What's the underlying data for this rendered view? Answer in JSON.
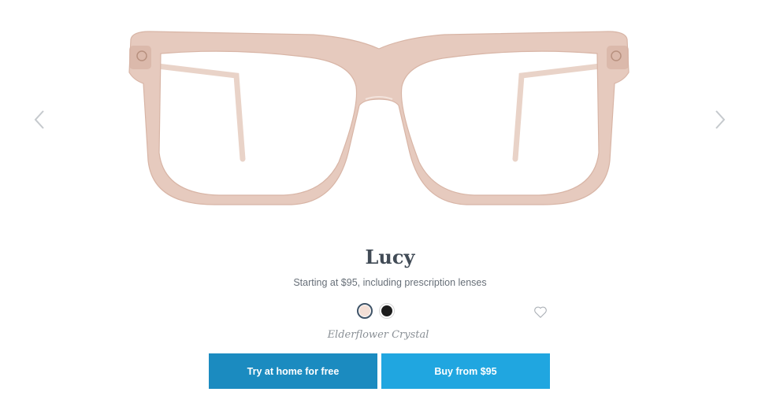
{
  "product": {
    "name": "Lucy",
    "price_text": "Starting at $95, including prescription lenses",
    "selected_color": "Elderflower Crystal"
  },
  "swatches": [
    {
      "name": "elderflower-crystal",
      "color": "#f3dfd6",
      "selected": true
    },
    {
      "name": "black",
      "color": "#1c1c1c",
      "selected": false
    }
  ],
  "actions": {
    "try_label": "Try at home for free",
    "buy_label": "Buy from $95"
  },
  "icons": {
    "prev": "chevron-left-icon",
    "next": "chevron-right-icon",
    "favorite": "heart-icon"
  },
  "colors": {
    "try_button": "#1b8bc0",
    "buy_button": "#20a6e0",
    "frame": "#e6c9bd",
    "title": "#414b56"
  }
}
